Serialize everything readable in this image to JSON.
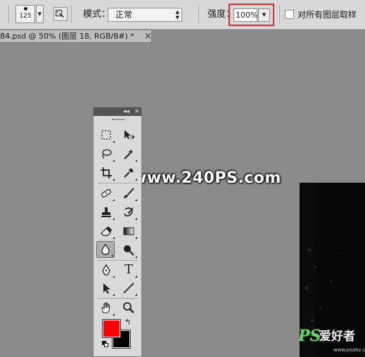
{
  "options_bar": {
    "brush_size": "125",
    "mode_label": "模式：",
    "mode_value": "正常",
    "strength_label": "强度：",
    "strength_value": "100%",
    "sample_all_layers_label": "对所有图层取样",
    "sample_all_layers_checked": false
  },
  "document_tab": {
    "title": "84.psd @ 50% (图层 18, RGB/8#) *",
    "close": "×"
  },
  "tools_panel": {
    "header_collapse": "◂◂",
    "header_close": "✕",
    "selected_tool": "blur-tool",
    "text_tool_glyph": "T",
    "swap_glyph": "↰",
    "foreground_color": "#ff0000",
    "background_color": "#000000"
  },
  "canvas": {
    "background": "#8b8b8b",
    "watermark": "www.240PS.com"
  },
  "site_logo": {
    "ps": "PS",
    "name": "爱好者",
    "url": "www.psahz.com"
  }
}
